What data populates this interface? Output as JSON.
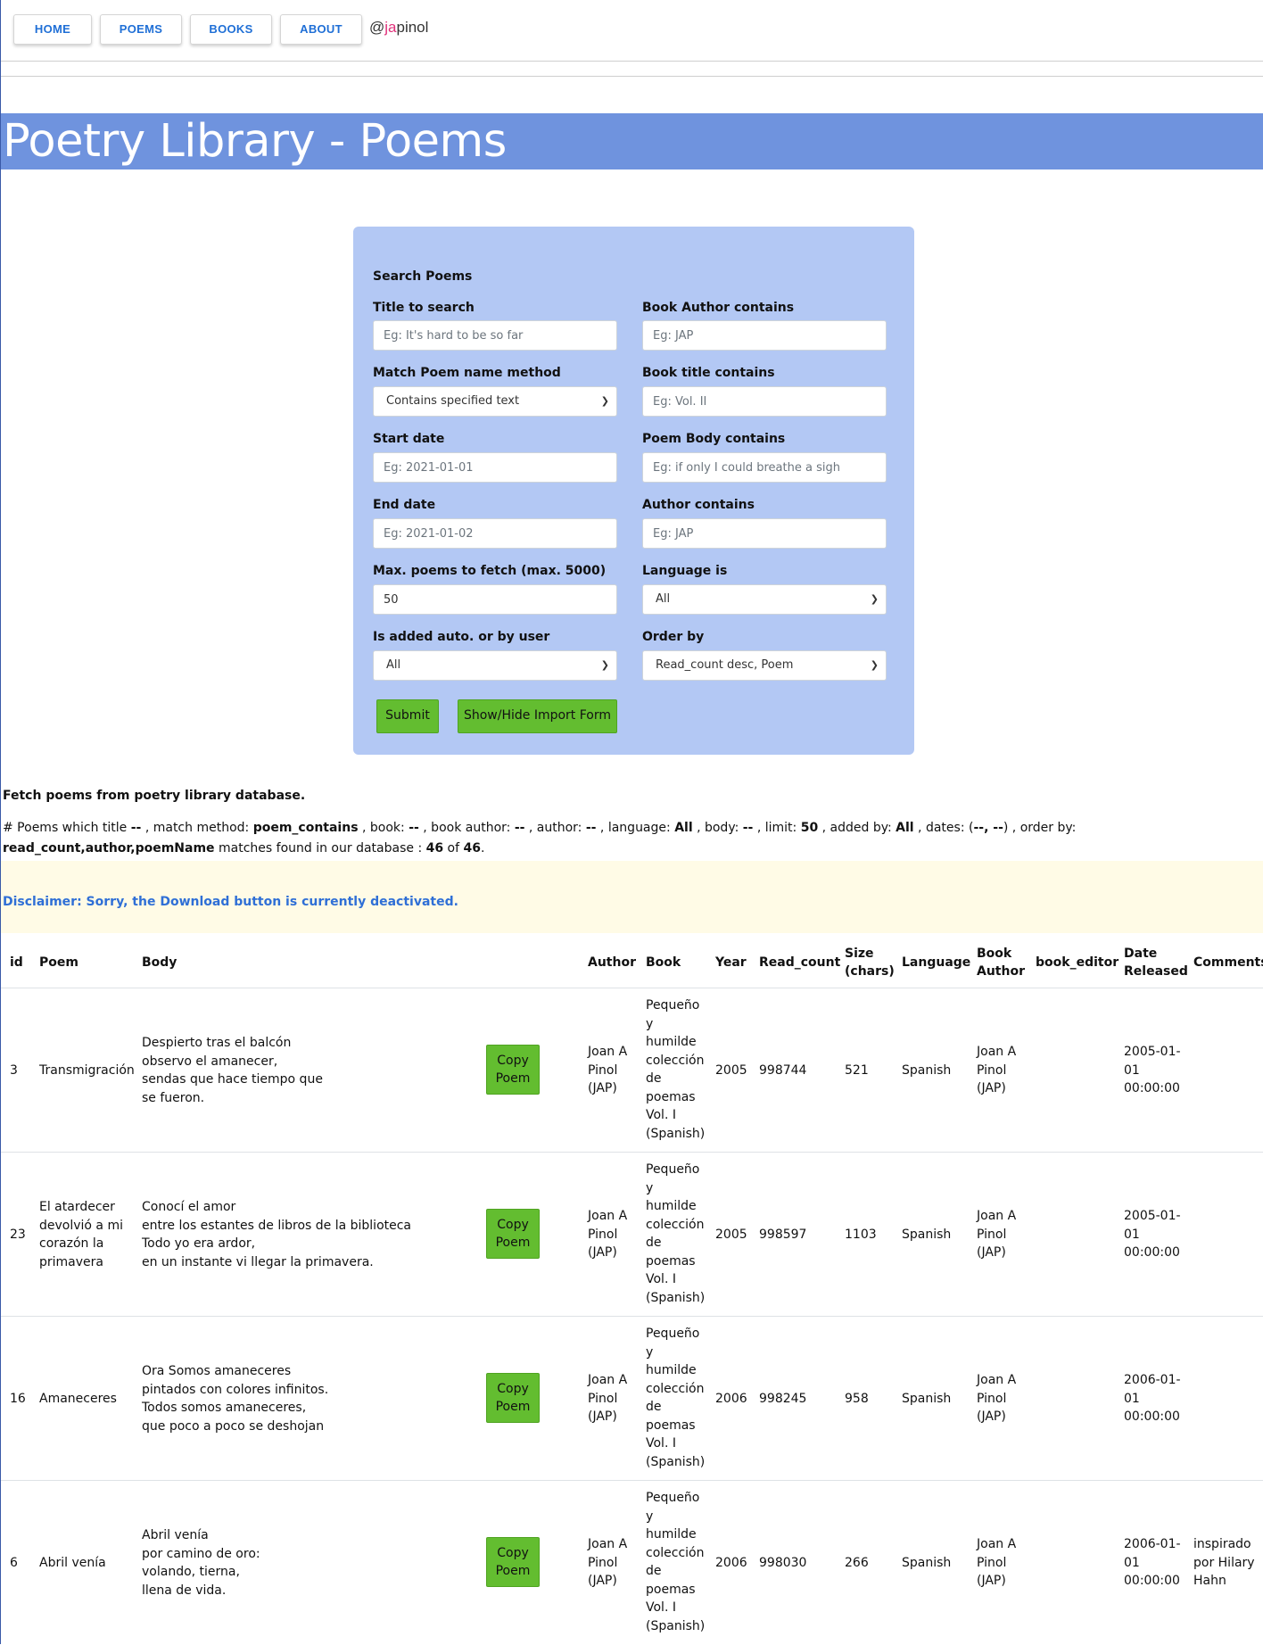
{
  "nav": {
    "items": [
      "HOME",
      "POEMS",
      "BOOKS",
      "ABOUT"
    ],
    "brand_prefix": "@",
    "brand_highlight": "ja",
    "brand_suffix": "pinol"
  },
  "header": {
    "title": "Poetry Library - Poems"
  },
  "search": {
    "title": "Search Poems",
    "title_label": "Title to search",
    "title_placeholder": "Eg: It's hard to be so far",
    "book_author_label": "Book Author contains",
    "book_author_placeholder": "Eg: JAP",
    "match_label": "Match Poem name method",
    "match_value": "Contains specified text",
    "book_title_label": "Book title contains",
    "book_title_placeholder": "Eg: Vol. II",
    "start_label": "Start date",
    "start_placeholder": "Eg: 2021-01-01",
    "body_label": "Poem Body contains",
    "body_placeholder": "Eg: if only I could breathe a sigh",
    "end_label": "End date",
    "end_placeholder": "Eg: 2021-01-02",
    "author_label": "Author contains",
    "author_placeholder": "Eg: JAP",
    "max_label": "Max. poems to fetch (max. 5000)",
    "max_value": "50",
    "language_label": "Language is",
    "language_value": "All",
    "added_label": "Is added auto. or by user",
    "added_value": "All",
    "order_label": "Order by",
    "order_value": "Read_count desc, Poem",
    "submit_label": "Submit",
    "import_label": "Show/Hide Import Form"
  },
  "info": {
    "fetch_title": "Fetch poems from poetry library database.",
    "summary": {
      "t1": "# Poems which title ",
      "title": "--",
      "t2": " , match method: ",
      "method": "poem_contains",
      "t3": " , book: ",
      "book": "--",
      "t4": " , book author: ",
      "book_author": "--",
      "t5": " , author: ",
      "author": "--",
      "t6": " , language: ",
      "language": "All",
      "t7": " , body: ",
      "body": "--",
      "t8": " , limit: ",
      "limit": "50",
      "t9": " , added by: ",
      "added_by": "All",
      "t10": " , dates: (",
      "dates": "--, --",
      "t11": ") , order by: ",
      "order": "read_count,author,poemName",
      "t12": " matches found in our database : ",
      "found": "46",
      "t13": " of ",
      "total": "46",
      "t14": "."
    },
    "disclaimer": "Disclaimer: Sorry, the Download button is currently deactivated."
  },
  "table": {
    "headers": [
      "id",
      "Poem",
      "Body",
      "Author",
      "Book",
      "Year",
      "Read_count",
      "Size\n(chars)",
      "Language",
      "Book\nAuthor",
      "book_editor",
      "Date\nReleased",
      "Comments"
    ],
    "copy_label": "Copy\nPoem",
    "rows": [
      {
        "id": "3",
        "poem": "Transmigración",
        "body": "Despierto tras el balcón\nobservo el amanecer,\nsendas que hace tiempo que\nse fueron.",
        "author": "Joan A\nPinol\n(JAP)",
        "book": "Pequeño\ny\nhumilde\ncolección\nde\npoemas\nVol. I\n(Spanish)",
        "year": "2005",
        "read_count": "998744",
        "size": "521",
        "language": "Spanish",
        "book_author": "Joan A\nPinol\n(JAP)",
        "book_editor": "",
        "date": "2005-01-\n01\n00:00:00",
        "comments": ""
      },
      {
        "id": "23",
        "poem": "El atardecer\ndevolvió a mi\ncorazón la\nprimavera",
        "body": "Conocí el amor\nentre los estantes de libros de la biblioteca\nTodo yo era ardor,\nen un instante vi llegar la primavera.",
        "author": "Joan A\nPinol\n(JAP)",
        "book": "Pequeño\ny\nhumilde\ncolección\nde\npoemas\nVol. I\n(Spanish)",
        "year": "2005",
        "read_count": "998597",
        "size": "1103",
        "language": "Spanish",
        "book_author": "Joan A\nPinol\n(JAP)",
        "book_editor": "",
        "date": "2005-01-\n01\n00:00:00",
        "comments": ""
      },
      {
        "id": "16",
        "poem": "Amaneceres",
        "body": "Ora Somos amaneceres\npintados con colores infinitos.\nTodos somos amaneceres,\nque poco a poco se deshojan",
        "author": "Joan A\nPinol\n(JAP)",
        "book": "Pequeño\ny\nhumilde\ncolección\nde\npoemas\nVol. I\n(Spanish)",
        "year": "2006",
        "read_count": "998245",
        "size": "958",
        "language": "Spanish",
        "book_author": "Joan A\nPinol\n(JAP)",
        "book_editor": "",
        "date": "2006-01-\n01\n00:00:00",
        "comments": ""
      },
      {
        "id": "6",
        "poem": "Abril venía",
        "body": "Abril venía\npor camino de oro:\nvolando, tierna,\nllena de vida.",
        "author": "Joan A\nPinol\n(JAP)",
        "book": "Pequeño\ny\nhumilde\ncolección\nde\npoemas\nVol. I\n(Spanish)",
        "year": "2006",
        "read_count": "998030",
        "size": "266",
        "language": "Spanish",
        "book_author": "Joan A\nPinol\n(JAP)",
        "book_editor": "",
        "date": "2006-01-\n01\n00:00:00",
        "comments": "inspirado\npor Hilary\nHahn"
      }
    ]
  }
}
